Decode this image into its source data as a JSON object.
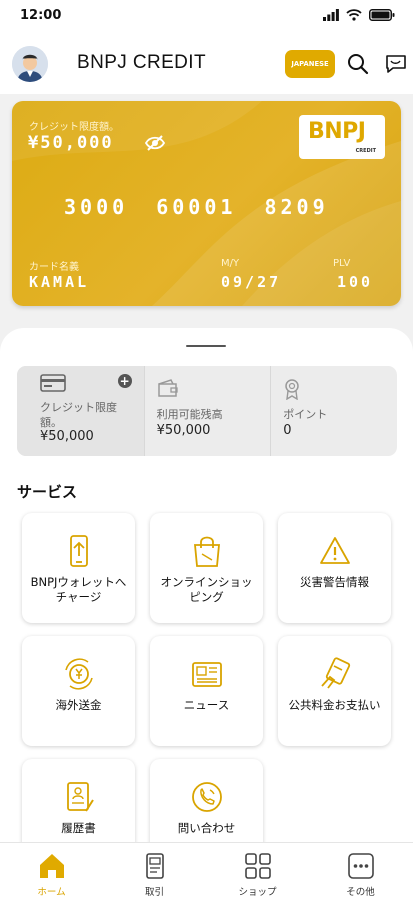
{
  "status_bar": {
    "time": "12:00"
  },
  "header": {
    "title": "BNPJ CREDIT",
    "language_button": "JAPANESE"
  },
  "card": {
    "limit_label": "クレジット限度額。",
    "limit_value": "¥50,000",
    "brand": "BNPJ",
    "brand_sub": "CREDIT",
    "number": "3000 60001 8209",
    "name_label": "カード名義",
    "name": "KAMAL",
    "my_label": "M/Y",
    "my": "09/27",
    "plv_label": "PLV",
    "plv": "100"
  },
  "summary": [
    {
      "label": "クレジット限度額。",
      "value": "¥50,000",
      "icon": "card-icon"
    },
    {
      "label": "利用可能残高",
      "value": "¥50,000",
      "icon": "wallet-icon"
    },
    {
      "label": "ポイント",
      "value": "0",
      "icon": "medal-icon"
    }
  ],
  "services_title": "サービス",
  "services": [
    {
      "label": "BNPJウォレットへチャージ",
      "icon": "phone-upload-icon"
    },
    {
      "label": "オンラインショッピング",
      "icon": "shopping-bag-icon"
    },
    {
      "label": "災害警告情報",
      "icon": "warning-icon"
    },
    {
      "label": "海外送金",
      "icon": "yen-transfer-icon"
    },
    {
      "label": "ニュース",
      "icon": "newspaper-icon"
    },
    {
      "label": "公共料金お支払い",
      "icon": "card-payment-icon"
    },
    {
      "label": "履歴書",
      "icon": "resume-icon"
    },
    {
      "label": "問い合わせ",
      "icon": "phone-call-icon"
    }
  ],
  "tabs": [
    {
      "label": "ホーム",
      "icon": "home-icon",
      "active": true
    },
    {
      "label": "取引",
      "icon": "transactions-icon"
    },
    {
      "label": "ショップ",
      "icon": "shop-grid-icon"
    },
    {
      "label": "その他",
      "icon": "more-icon"
    }
  ],
  "colors": {
    "accent": "#e0aa00",
    "card": "#dcab12"
  }
}
